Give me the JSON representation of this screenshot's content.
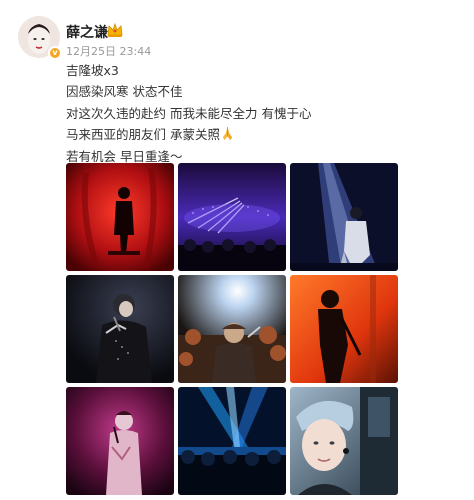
{
  "post": {
    "username": "薛之谦",
    "timestamp": "12月25日 23:44",
    "verified_badge": "v",
    "lines": [
      "吉隆坡x3",
      "因感染风寒 状态不佳",
      "对这次久违的赴约 而我未能尽全力 有愧于心",
      "马来西亚的朋友们 承蒙关照",
      "若有机会 早日重逢～"
    ],
    "line4_emoji": "praying-hands-icon"
  },
  "photos": [
    {
      "name": "photo-red-stage",
      "accent": "#c4161c"
    },
    {
      "name": "photo-arena-purple",
      "accent": "#5a3bd0"
    },
    {
      "name": "photo-spotlight-blue",
      "accent": "#2a3b8f"
    },
    {
      "name": "photo-singer-dark",
      "accent": "#1a1a22"
    },
    {
      "name": "photo-crowd-warm",
      "accent": "#7a4a2a"
    },
    {
      "name": "photo-orange-stage",
      "accent": "#e04a12"
    },
    {
      "name": "photo-pink-stage",
      "accent": "#8c1a5c"
    },
    {
      "name": "photo-blue-beams",
      "accent": "#0a5fb0"
    },
    {
      "name": "photo-selfie",
      "accent": "#6a8aa8"
    }
  ]
}
